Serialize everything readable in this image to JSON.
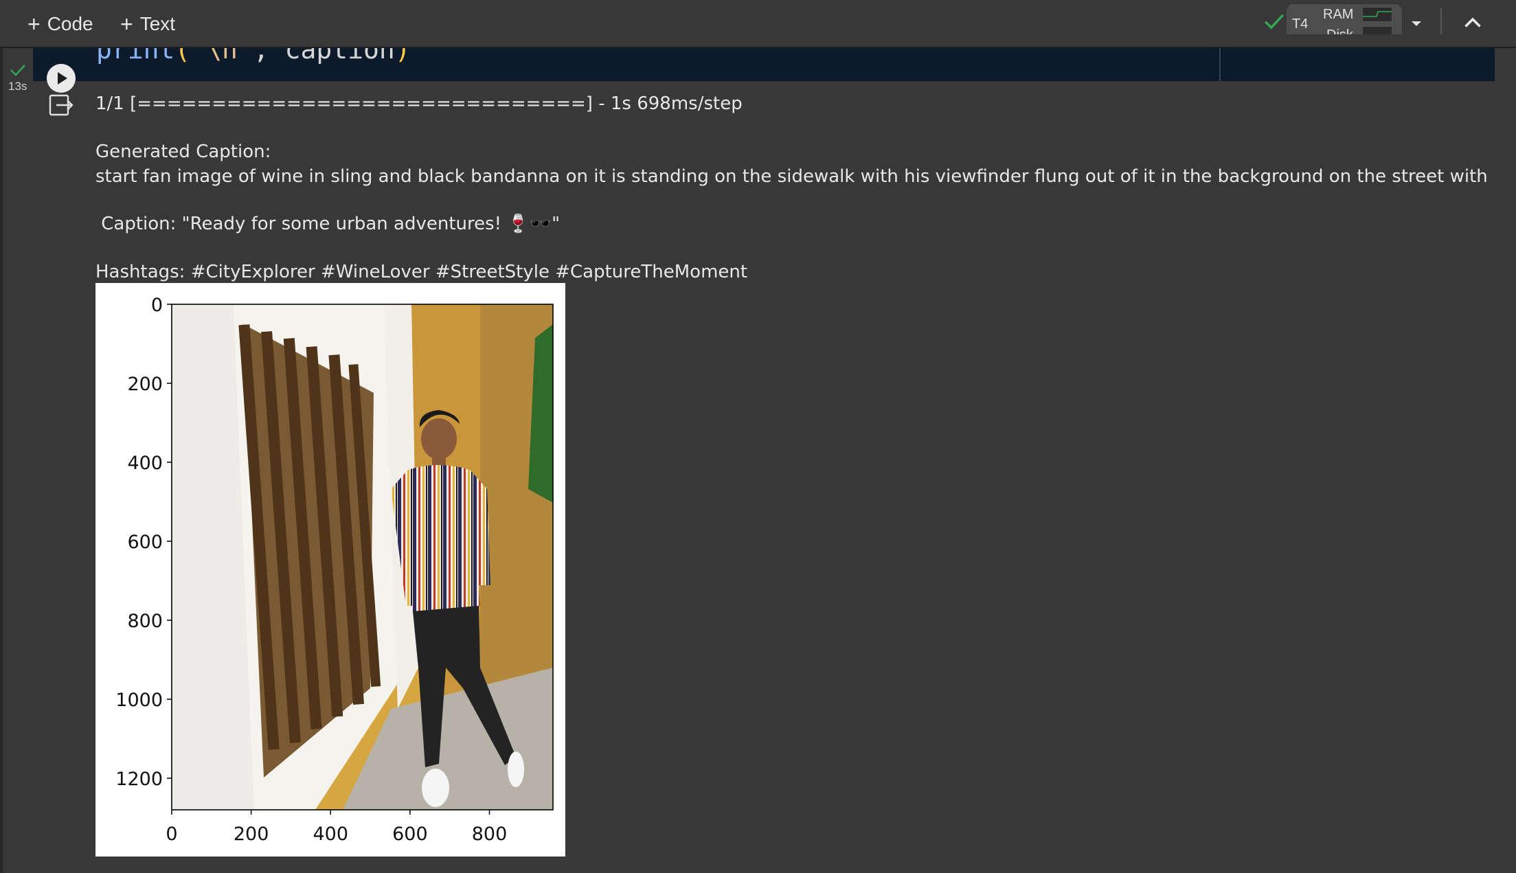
{
  "toolbar": {
    "add_code_label": "Code",
    "add_text_label": "Text",
    "runtime": {
      "gpu_label": "T4",
      "ram_label": "RAM",
      "disk_label": "Disk"
    }
  },
  "cell": {
    "exec_time": "13s",
    "code": {
      "fn": "print",
      "open_paren": "(",
      "str_arg": " \\n ",
      "sep": ", ",
      "var": "caption",
      "close_paren": ")"
    }
  },
  "output": {
    "progress_line": "1/1 [==============================] - 1s 698ms/step",
    "generated_caption_label": "Generated Caption:",
    "generated_caption_text": "start fan image of wine in sling and black bandanna on it is standing on the sidewalk with his viewfinder flung out of it in the background on the street with h",
    "caption_line": " Caption: \"Ready for some urban adventures! 🍷🕶️\"",
    "hashtags_line": "Hashtags: #CityExplorer #WineLover #StreetStyle #CaptureTheMoment"
  },
  "chart_data": {
    "type": "image",
    "x_ticks": [
      "0",
      "200",
      "400",
      "600",
      "800"
    ],
    "y_ticks": [
      "0",
      "200",
      "400",
      "600",
      "800",
      "1000",
      "1200"
    ],
    "xlim": [
      0,
      960
    ],
    "ylim": [
      1280,
      0
    ],
    "image_description": "photo of a man in a striped shirt leaning against a yellow wall beside a wooden-barred window"
  },
  "colors": {
    "background": "#383838",
    "code_bg": "#0d1a2b",
    "check_green": "#34a853",
    "wall_yellow": "#d9a93f"
  }
}
